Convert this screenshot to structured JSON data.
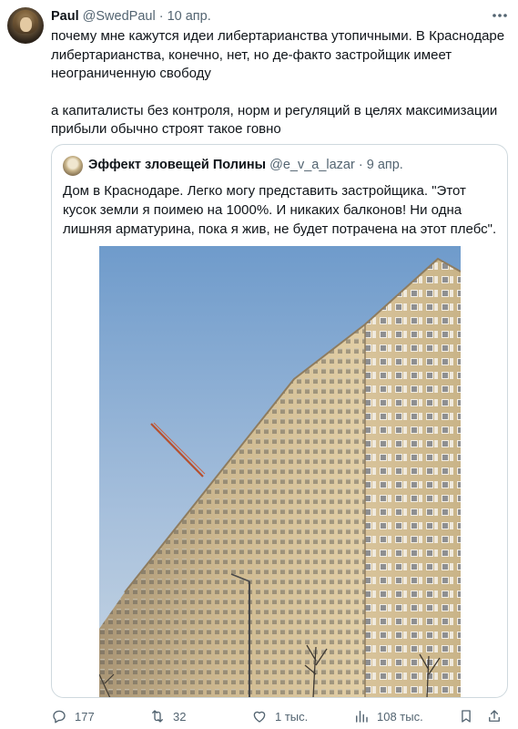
{
  "tweet": {
    "author_name": "Paul",
    "handle": "@SwedPaul",
    "separator": "·",
    "date": "10 апр.",
    "paragraphs": [
      "почему мне кажутся идеи либертарианства утопичными. В Краснодаре либертарианства, конечно, нет, но де-факто застройщик имеет неограниченную свободу",
      "а капиталисты без контроля, норм и регуляций в целях максимизации прибыли обычно строят такое говно"
    ]
  },
  "quote": {
    "author_name": "Эффект зловещей Полины",
    "handle": "@e_v_a_lazar",
    "separator": "·",
    "date": "9 апр.",
    "text": "Дом в Краснодаре. Легко могу представить застройщика. \"Этот кусок земли я поимею на 1000%. И никаких балконов! Ни одна лишняя арматурина, пока я жив, не будет потрачена на этот плебс\"."
  },
  "actions": {
    "replies": "177",
    "reposts": "32",
    "likes": "1 тыс.",
    "views": "108 тыс."
  },
  "icons": {
    "more": "more-horizontal-icon",
    "reply": "reply-bubble-icon",
    "repost": "repost-icon",
    "like": "heart-icon",
    "views": "views-bar-chart-icon",
    "bookmark": "bookmark-icon",
    "share": "share-icon"
  },
  "colors": {
    "text": "#0f1419",
    "secondary": "#536471",
    "border": "#cfd9de",
    "sky_top": "#7aa3cf",
    "sky_bottom": "#b7cce0",
    "building_lit": "#d9c49a",
    "building_shadow": "#a9987a"
  }
}
